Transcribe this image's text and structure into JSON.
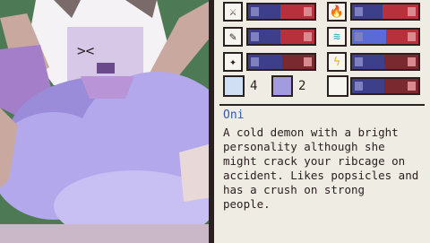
{
  "character": {
    "name": "Oni",
    "description": "A cold demon with a bright\npersonality although she\nmight crack your ribcage on\naccident. Likes popsicles and\nhas a crush on strong\npeople."
  },
  "stats_left": [
    {
      "icon": "dagger-icon",
      "glyph": "⚔"
    },
    {
      "icon": "syringe-icon",
      "glyph": "✎"
    },
    {
      "icon": "wand-icon",
      "glyph": "✦"
    }
  ],
  "stats_right": [
    {
      "icon": "fire-icon",
      "glyph": "🔥"
    },
    {
      "icon": "water-icon",
      "glyph": "≋"
    },
    {
      "icon": "lightning-icon",
      "glyph": "ϟ"
    }
  ],
  "tallies": {
    "shield_count": "4",
    "cross_count": "2"
  },
  "colors": {
    "name": "#2f5da8",
    "bar_blue": "#3d3f8a",
    "bar_red": "#b8303b",
    "background_green": "#4d7a55"
  }
}
